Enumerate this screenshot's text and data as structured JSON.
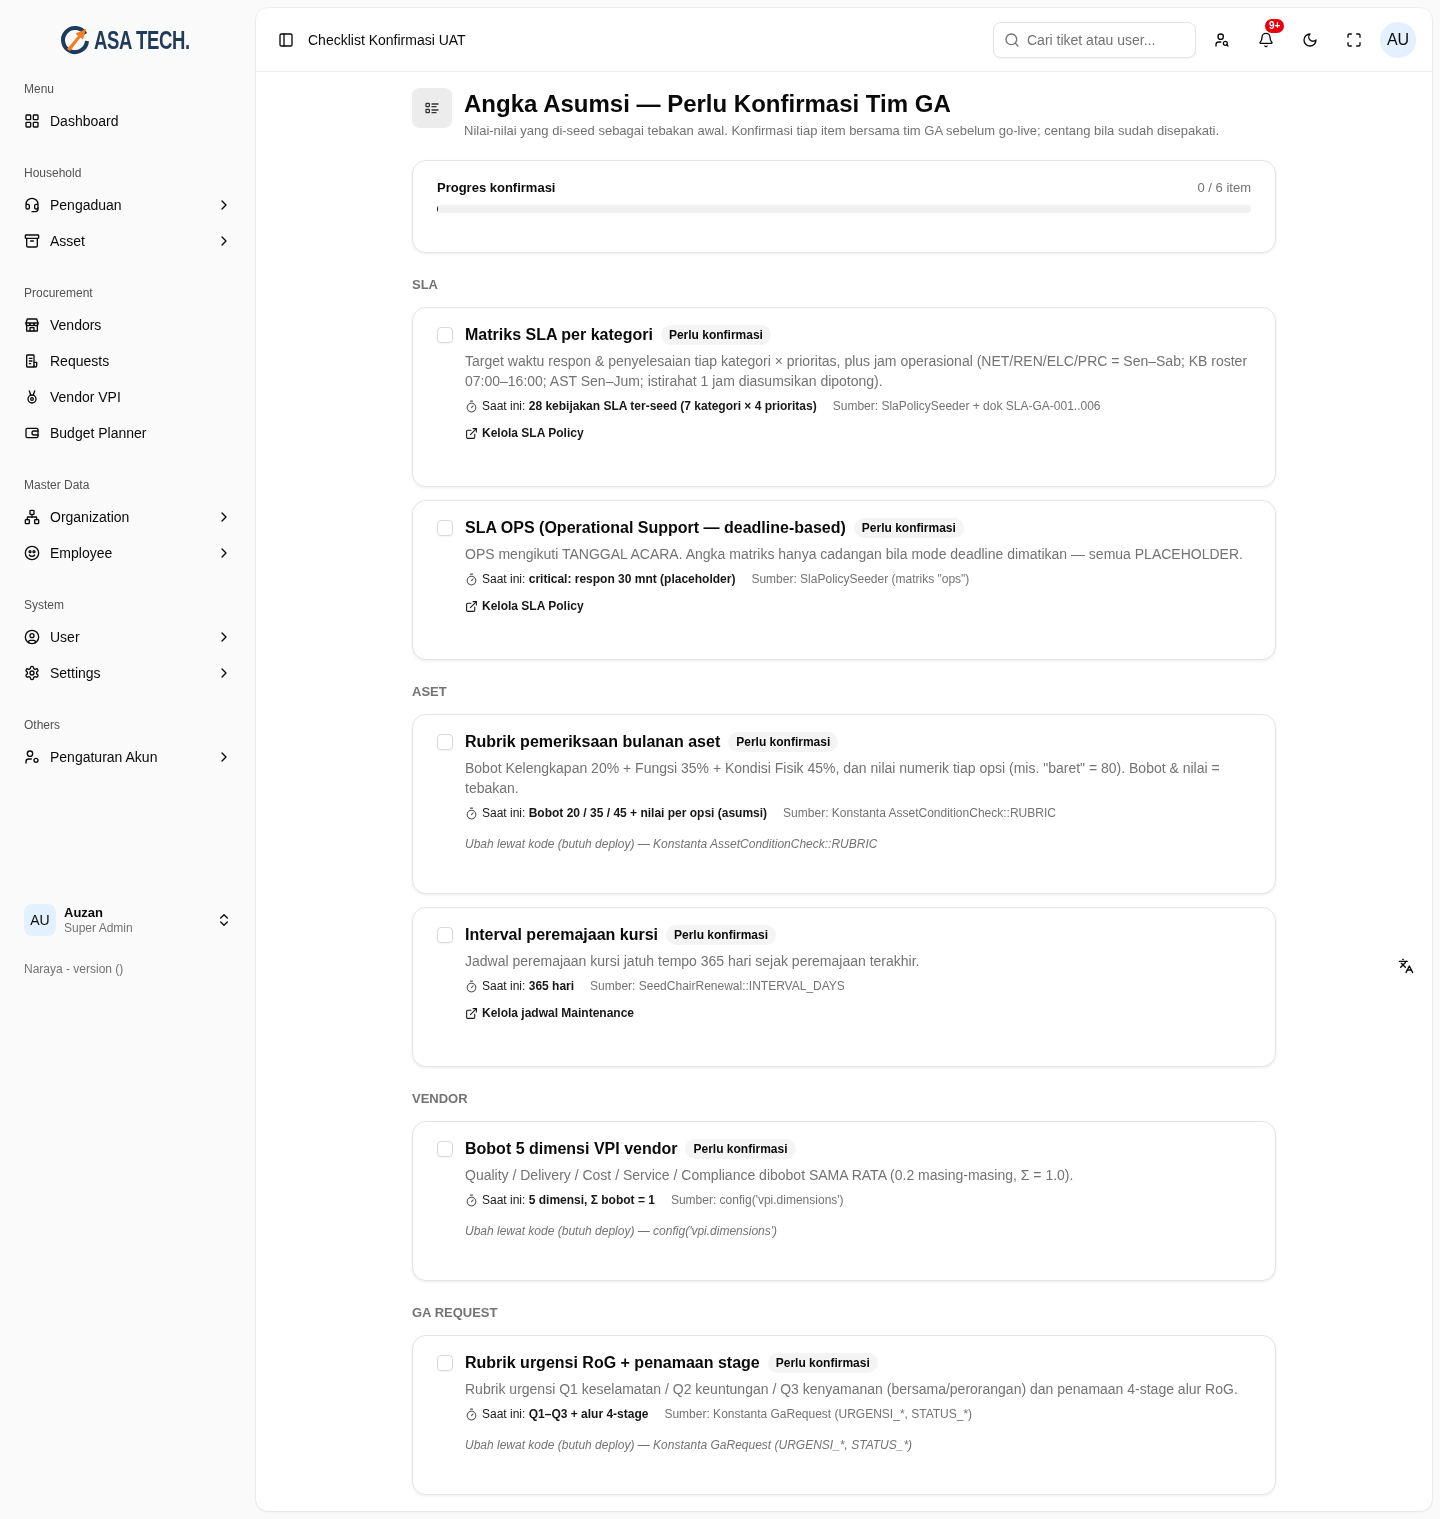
{
  "sidebar": {
    "logo": {
      "text": "ASA TECH."
    },
    "groups": [
      {
        "label": "Menu",
        "items": [
          {
            "label": "Dashboard",
            "has_submenu": false,
            "selected": false
          }
        ]
      },
      {
        "label": "Household",
        "items": [
          {
            "label": "Pengaduan",
            "has_submenu": true,
            "selected": false
          },
          {
            "label": "Asset",
            "has_submenu": true,
            "selected": false
          }
        ]
      },
      {
        "label": "Procurement",
        "items": [
          {
            "label": "Vendors",
            "has_submenu": false,
            "selected": false
          },
          {
            "label": "Requests",
            "has_submenu": false,
            "selected": false
          },
          {
            "label": "Vendor VPI",
            "has_submenu": false,
            "selected": false
          },
          {
            "label": "Budget Planner",
            "has_submenu": false,
            "selected": false
          }
        ]
      },
      {
        "label": "Master Data",
        "items": [
          {
            "label": "Organization",
            "has_submenu": true,
            "selected": false
          },
          {
            "label": "Employee",
            "has_submenu": true,
            "selected": false
          }
        ]
      },
      {
        "label": "System",
        "items": [
          {
            "label": "User",
            "has_submenu": true,
            "selected": false
          },
          {
            "label": "Settings",
            "has_submenu": true,
            "selected": false
          }
        ]
      },
      {
        "label": "Others",
        "items": [
          {
            "label": "Pengaturan Akun",
            "has_submenu": true,
            "selected": false
          }
        ]
      }
    ],
    "user": {
      "initials": "AU",
      "name": "Auzan",
      "role": "Super Admin"
    },
    "footer": "Naraya - version ()"
  },
  "header": {
    "title": "Checklist Konfirmasi UAT",
    "search": {
      "placeholder": "Cari tiket atau user..."
    },
    "notification_badge": "9+",
    "avatar": "AU"
  },
  "page": {
    "title": "Angka Asumsi — Perlu Konfirmasi Tim GA",
    "subtitle": "Nilai-nilai yang di-seed sebagai tebakan awal. Konfirmasi tiap item bersama tim GA sebelum go-live; centang bila sudah disepakati."
  },
  "progress": {
    "label": "Progres konfirmasi",
    "count": "0 / 6 item",
    "level": 0
  },
  "sections": [
    {
      "label": "SLA",
      "items": [
        {
          "checked": false,
          "title": "Matriks SLA per kategori",
          "badge": "Perlu konfirmasi",
          "description": "Target waktu respon & penyelesaian tiap kategori × prioritas, plus jam operasional (NET/REN/ELC/PRC = Sen–Sab; KB roster 07:00–16:00; AST Sen–Jum; istirahat 1 jam diasumsikan dipotong).",
          "current": "Saat ini: **28 kebijakan SLA ter-seed (7 kategori × 4 prioritas)**",
          "source": "Sumber: SlaPolicySeeder + dok SLA-GA-001..006",
          "action": {
            "kind": "link",
            "text": "Kelola SLA Policy"
          }
        },
        {
          "checked": false,
          "title": "SLA OPS (Operational Support — deadline-based)",
          "badge": "Perlu konfirmasi",
          "description": "OPS mengikuti TANGGAL ACARA. Angka matriks hanya cadangan bila mode deadline dimatikan — semua PLACEHOLDER.",
          "current": "Saat ini: **critical: respon 30 mnt (placeholder)**",
          "source": "Sumber: SlaPolicySeeder (matriks \"ops\")",
          "action": {
            "kind": "link",
            "text": "Kelola SLA Policy"
          }
        }
      ]
    },
    {
      "label": "ASET",
      "items": [
        {
          "checked": false,
          "title": "Rubrik pemeriksaan bulanan aset",
          "badge": "Perlu konfirmasi",
          "description": "Bobot Kelengkapan 20% + Fungsi 35% + Kondisi Fisik 45%, dan nilai numerik tiap opsi (mis. \"baret\" = 80). Bobot & nilai = tebakan.",
          "current": "Saat ini: **Bobot 20 / 35 / 45 + nilai per opsi (asumsi)**",
          "source": "Sumber: Konstanta AssetConditionCheck::RUBRIC",
          "action": {
            "kind": "note",
            "text": "Ubah lewat kode (butuh deploy) — Konstanta AssetConditionCheck::RUBRIC"
          }
        },
        {
          "checked": false,
          "title": "Interval peremajaan kursi",
          "badge": "Perlu konfirmasi",
          "description": "Jadwal peremajaan kursi jatuh tempo 365 hari sejak peremajaan terakhir.",
          "current": "Saat ini: **365 hari**",
          "source": "Sumber: SeedChairRenewal::INTERVAL_DAYS",
          "action": {
            "kind": "link",
            "text": "Kelola jadwal Maintenance"
          }
        }
      ]
    },
    {
      "label": "VENDOR",
      "items": [
        {
          "checked": false,
          "title": "Bobot 5 dimensi VPI vendor",
          "badge": "Perlu konfirmasi",
          "description": "Quality / Delivery / Cost / Service / Compliance dibobot SAMA RATA (0.2 masing-masing, Σ = 1.0).",
          "current": "Saat ini: **5 dimensi, Σ bobot = 1**",
          "source": "Sumber: config('vpi.dimensions')",
          "action": {
            "kind": "note",
            "text": "Ubah lewat kode (butuh deploy) — config('vpi.dimensions')"
          }
        }
      ]
    },
    {
      "label": "GA REQUEST",
      "items": [
        {
          "checked": false,
          "title": "Rubrik urgensi RoG + penamaan stage",
          "badge": "Perlu konfirmasi",
          "description": "Rubrik urgensi Q1 keselamatan / Q2 keuntungan / Q3 kenyamanan (bersama/perorangan) dan penamaan 4-stage alur RoG.",
          "current": "Saat ini: **Q1–Q3 + alur 4-stage**",
          "source": "Sumber: Konstanta GaRequest (URGENSI_*, STATUS_*)",
          "action": {
            "kind": "note",
            "text": "Ubah lewat kode (butuh deploy) — Konstanta GaRequest (URGENSI_*, STATUS_*)"
          }
        }
      ]
    }
  ]
}
